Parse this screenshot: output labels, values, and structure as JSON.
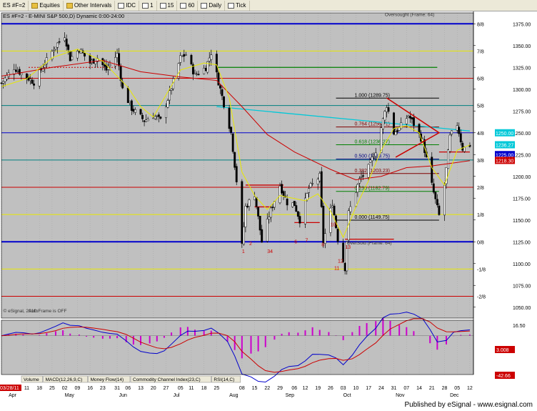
{
  "toolbar": {
    "symbol": "ES #F=2",
    "items": [
      "Equities",
      "Other Intervals",
      "IDC",
      "1",
      "15",
      "60",
      "Daily",
      "Tick"
    ]
  },
  "chart_data": {
    "type": "candlestick",
    "title": "ES #F=2 - E-MINI S&P 500,D) Dynamic 0:00-24:00",
    "colors": {
      "background": "#c0c0c0",
      "up": "#ffffff",
      "down": "#000000",
      "ema_fast": "#e8e800",
      "ema_slow": "#cc0000",
      "cyan": "#00c8d8",
      "murray_blue": "#0000cc"
    },
    "ylim": [
      1037.5,
      1387.5
    ],
    "y_ticks": [
      1375.0,
      1350.0,
      1325.0,
      1300.0,
      1275.0,
      1250.0,
      1225.0,
      1200.0,
      1175.0,
      1150.0,
      1125.0,
      1100.0,
      1075.0,
      1050.0
    ],
    "murray_lines": [
      {
        "label": "8/8",
        "value": 1375.0,
        "color": "#0000cc",
        "width": 2
      },
      {
        "label": "7/8",
        "value": 1343.75,
        "color": "#e8e800",
        "width": 1
      },
      {
        "label": "6/8",
        "value": 1312.5,
        "color": "#cc0000",
        "width": 1
      },
      {
        "label": "5/8",
        "value": 1281.25,
        "color": "#008080",
        "width": 1
      },
      {
        "label": "4/8",
        "value": 1250.0,
        "color": "#0000cc",
        "width": 1
      },
      {
        "label": "3/8",
        "value": 1218.75,
        "color": "#008080",
        "width": 1
      },
      {
        "label": "2/8",
        "value": 1187.5,
        "color": "#cc0000",
        "width": 1
      },
      {
        "label": "1/8",
        "value": 1156.25,
        "color": "#e8e800",
        "width": 1
      },
      {
        "label": "0/8",
        "value": 1125.0,
        "color": "#0000cc",
        "width": 2
      },
      {
        "label": "-1/8",
        "value": 1093.75,
        "color": "#e8e800",
        "width": 1
      },
      {
        "label": "-2/8",
        "value": 1062.5,
        "color": "#cc0000",
        "width": 1
      }
    ],
    "fib_levels": [
      {
        "label": "1.000 (1289.75)",
        "value": 1289.75,
        "color": "#000000"
      },
      {
        "label": "0.764 (1256.71)",
        "value": 1256.71,
        "color": "#800000"
      },
      {
        "label": "0.618 (1236.27)",
        "value": 1236.27,
        "color": "#008000"
      },
      {
        "label": "0.500 (1219.75)",
        "value": 1219.75,
        "color": "#000080"
      },
      {
        "label": "0.382 (1203.23)",
        "value": 1203.23,
        "color": "#800000"
      },
      {
        "label": "0.236 (1182.79)",
        "value": 1182.79,
        "color": "#008000"
      },
      {
        "label": "0.000 (1149.75)",
        "value": 1149.75,
        "color": "#000000"
      }
    ],
    "price_tags": [
      {
        "text": "1250.00",
        "value": 1250.0,
        "color": "#00c8d8"
      },
      {
        "text": "1236.27",
        "value": 1236.27,
        "color": "#00c8d8"
      },
      {
        "text": "1225.00",
        "value": 1225.0,
        "color": "#0000cc"
      },
      {
        "text": "1218.30",
        "value": 1218.3,
        "color": "#cc0000"
      }
    ],
    "annotations": [
      {
        "text": "Oversought (Frame: 64)",
        "x": "2011-10-26",
        "y": 1384
      },
      {
        "text": "OverSold (Frame: 64)",
        "x": "2011-10-05",
        "y": 1122
      },
      {
        "text": "© eSignal, 2010",
        "x": "2011-03-29",
        "y": 1044
      },
      {
        "text": "AutoFrame is OFF",
        "x": "2011-04-12",
        "y": 1044
      }
    ],
    "countdown": [
      {
        "text": "1",
        "x": "2011-08-08",
        "y": 1112
      },
      {
        "text": "2",
        "x": "2011-08-12",
        "y": 1121
      },
      {
        "text": "34",
        "x": "2011-08-22",
        "y": 1112
      },
      {
        "text": "6",
        "x": "2011-09-06",
        "y": 1123
      },
      {
        "text": "7",
        "x": "2011-09-12",
        "y": 1125
      },
      {
        "text": "8",
        "x": "2011-09-21",
        "y": 1120
      },
      {
        "text": "10",
        "x": "2011-09-26",
        "y": 1143
      },
      {
        "text": "11",
        "x": "2011-09-28",
        "y": 1093
      },
      {
        "text": "12",
        "x": "2011-09-30",
        "y": 1101
      },
      {
        "text": "13",
        "x": "2011-10-04",
        "y": 1117
      }
    ],
    "x_months": [
      {
        "label": "Apr",
        "date": "2011-04-01"
      },
      {
        "label": "May",
        "date": "2011-05-02"
      },
      {
        "label": "Jun",
        "date": "2011-06-01"
      },
      {
        "label": "Jul",
        "date": "2011-07-01"
      },
      {
        "label": "Aug",
        "date": "2011-08-01"
      },
      {
        "label": "Sep",
        "date": "2011-09-01"
      },
      {
        "label": "Oct",
        "date": "2011-10-03"
      },
      {
        "label": "Nov",
        "date": "2011-11-01"
      },
      {
        "label": "Dec",
        "date": "2011-12-01"
      }
    ],
    "x_days": [
      {
        "label": "03/28/11",
        "date": "2011-03-28"
      },
      {
        "label": "11",
        "date": "2011-04-11"
      },
      {
        "label": "18",
        "date": "2011-04-18"
      },
      {
        "label": "25",
        "date": "2011-04-25"
      },
      {
        "label": "02",
        "date": "2011-05-02"
      },
      {
        "label": "09",
        "date": "2011-05-09"
      },
      {
        "label": "16",
        "date": "2011-05-16"
      },
      {
        "label": "23",
        "date": "2011-05-23"
      },
      {
        "label": "31",
        "date": "2011-05-31"
      },
      {
        "label": "06",
        "date": "2011-06-06"
      },
      {
        "label": "13",
        "date": "2011-06-13"
      },
      {
        "label": "20",
        "date": "2011-06-20"
      },
      {
        "label": "27",
        "date": "2011-06-27"
      },
      {
        "label": "05",
        "date": "2011-07-05"
      },
      {
        "label": "11",
        "date": "2011-07-11"
      },
      {
        "label": "18",
        "date": "2011-07-18"
      },
      {
        "label": "25",
        "date": "2011-07-25"
      },
      {
        "label": "08",
        "date": "2011-08-08"
      },
      {
        "label": "15",
        "date": "2011-08-15"
      },
      {
        "label": "22",
        "date": "2011-08-22"
      },
      {
        "label": "29",
        "date": "2011-08-29"
      },
      {
        "label": "06",
        "date": "2011-09-06"
      },
      {
        "label": "12",
        "date": "2011-09-12"
      },
      {
        "label": "19",
        "date": "2011-09-19"
      },
      {
        "label": "26",
        "date": "2011-09-26"
      },
      {
        "label": "03",
        "date": "2011-10-03"
      },
      {
        "label": "10",
        "date": "2011-10-10"
      },
      {
        "label": "17",
        "date": "2011-10-17"
      },
      {
        "label": "24",
        "date": "2011-10-24"
      },
      {
        "label": "31",
        "date": "2011-10-31"
      },
      {
        "label": "07",
        "date": "2011-11-07"
      },
      {
        "label": "14",
        "date": "2011-11-14"
      },
      {
        "label": "21",
        "date": "2011-11-21"
      },
      {
        "label": "28",
        "date": "2011-11-28"
      },
      {
        "label": "05",
        "date": "2011-12-05"
      },
      {
        "label": "12",
        "date": "2011-12-12"
      }
    ],
    "price_path": [
      [
        "2011-03-28",
        1307
      ],
      [
        "2011-04-04",
        1325
      ],
      [
        "2011-04-08",
        1318
      ],
      [
        "2011-04-15",
        1308
      ],
      [
        "2011-04-20",
        1326
      ],
      [
        "2011-04-27",
        1350
      ],
      [
        "2011-05-02",
        1362
      ],
      [
        "2011-05-05",
        1335
      ],
      [
        "2011-05-10",
        1346
      ],
      [
        "2011-05-16",
        1330
      ],
      [
        "2011-05-20",
        1336
      ],
      [
        "2011-05-25",
        1322
      ],
      [
        "2011-05-31",
        1340
      ],
      [
        "2011-06-03",
        1300
      ],
      [
        "2011-06-08",
        1278
      ],
      [
        "2011-06-15",
        1264
      ],
      [
        "2011-06-20",
        1270
      ],
      [
        "2011-06-24",
        1264
      ],
      [
        "2011-06-29",
        1295
      ],
      [
        "2011-07-05",
        1336
      ],
      [
        "2011-07-08",
        1340
      ],
      [
        "2011-07-13",
        1316
      ],
      [
        "2011-07-19",
        1325
      ],
      [
        "2011-07-22",
        1342
      ],
      [
        "2011-07-27",
        1300
      ],
      [
        "2011-08-02",
        1250
      ],
      [
        "2011-08-05",
        1195
      ],
      [
        "2011-08-08",
        1120
      ],
      [
        "2011-08-10",
        1165
      ],
      [
        "2011-08-15",
        1180
      ],
      [
        "2011-08-19",
        1125
      ],
      [
        "2011-08-23",
        1155
      ],
      [
        "2011-08-29",
        1190
      ],
      [
        "2011-09-02",
        1170
      ],
      [
        "2011-09-06",
        1168
      ],
      [
        "2011-09-09",
        1150
      ],
      [
        "2011-09-14",
        1186
      ],
      [
        "2011-09-20",
        1200
      ],
      [
        "2011-09-22",
        1125
      ],
      [
        "2011-09-27",
        1170
      ],
      [
        "2011-09-30",
        1128
      ],
      [
        "2011-10-04",
        1095
      ],
      [
        "2011-10-06",
        1158
      ],
      [
        "2011-10-12",
        1196
      ],
      [
        "2011-10-17",
        1210
      ],
      [
        "2011-10-21",
        1230
      ],
      [
        "2011-10-27",
        1282
      ],
      [
        "2011-10-31",
        1250
      ],
      [
        "2011-11-03",
        1255
      ],
      [
        "2011-11-08",
        1270
      ],
      [
        "2011-11-11",
        1260
      ],
      [
        "2011-11-16",
        1240
      ],
      [
        "2011-11-21",
        1190
      ],
      [
        "2011-11-25",
        1155
      ],
      [
        "2011-11-28",
        1190
      ],
      [
        "2011-12-01",
        1245
      ],
      [
        "2011-12-05",
        1260
      ],
      [
        "2011-12-08",
        1232
      ],
      [
        "2011-12-12",
        1236
      ]
    ],
    "ema_fast": [
      [
        "2011-03-28",
        1303
      ],
      [
        "2011-04-11",
        1312
      ],
      [
        "2011-04-25",
        1336
      ],
      [
        "2011-05-09",
        1346
      ],
      [
        "2011-05-23",
        1332
      ],
      [
        "2011-06-06",
        1302
      ],
      [
        "2011-06-13",
        1280
      ],
      [
        "2011-06-20",
        1268
      ],
      [
        "2011-07-05",
        1322
      ],
      [
        "2011-07-18",
        1330
      ],
      [
        "2011-07-25",
        1328
      ],
      [
        "2011-08-01",
        1290
      ],
      [
        "2011-08-08",
        1205
      ],
      [
        "2011-08-15",
        1178
      ],
      [
        "2011-08-22",
        1162
      ],
      [
        "2011-08-29",
        1178
      ],
      [
        "2011-09-12",
        1172
      ],
      [
        "2011-09-19",
        1180
      ],
      [
        "2011-09-26",
        1160
      ],
      [
        "2011-10-03",
        1130
      ],
      [
        "2011-10-10",
        1165
      ],
      [
        "2011-10-17",
        1195
      ],
      [
        "2011-10-24",
        1230
      ],
      [
        "2011-10-31",
        1255
      ],
      [
        "2011-11-07",
        1258
      ],
      [
        "2011-11-14",
        1250
      ],
      [
        "2011-11-21",
        1210
      ],
      [
        "2011-11-28",
        1190
      ],
      [
        "2011-12-05",
        1230
      ],
      [
        "2011-12-12",
        1236
      ]
    ],
    "ema_slow": [
      [
        "2011-03-28",
        1315
      ],
      [
        "2011-04-25",
        1325
      ],
      [
        "2011-05-23",
        1333
      ],
      [
        "2011-06-13",
        1320
      ],
      [
        "2011-07-05",
        1314
      ],
      [
        "2011-07-25",
        1310
      ],
      [
        "2011-08-08",
        1280
      ],
      [
        "2011-08-22",
        1248
      ],
      [
        "2011-09-06",
        1228
      ],
      [
        "2011-09-26",
        1208
      ],
      [
        "2011-10-10",
        1196
      ],
      [
        "2011-10-24",
        1200
      ],
      [
        "2011-11-07",
        1210
      ],
      [
        "2011-11-21",
        1212
      ],
      [
        "2011-12-12",
        1218
      ]
    ],
    "cyan_line": [
      [
        "2011-07-25",
        1280
      ],
      [
        "2011-10-24",
        1262
      ],
      [
        "2011-12-12",
        1252
      ]
    ],
    "green_line": [
      [
        "2011-07-25",
        1325
      ],
      [
        "2011-11-24",
        1325
      ]
    ],
    "red_triangle": [
      [
        "2011-10-27",
        1290
      ],
      [
        "2011-11-25",
        1250
      ],
      [
        "2011-11-01",
        1222
      ],
      [
        "2011-11-25",
        1250
      ]
    ],
    "panel_labels": {
      "indicators": [
        "Volume",
        "MACD(12,26,9,C)",
        "Money Flow(14)",
        "Commodity Channel Index(23,C)",
        "RSI(14,C)"
      ],
      "macd_ticks": [
        "16.50",
        "3.008",
        "-42.66"
      ]
    },
    "status": "Published by eSignal - www.esignal.com"
  }
}
